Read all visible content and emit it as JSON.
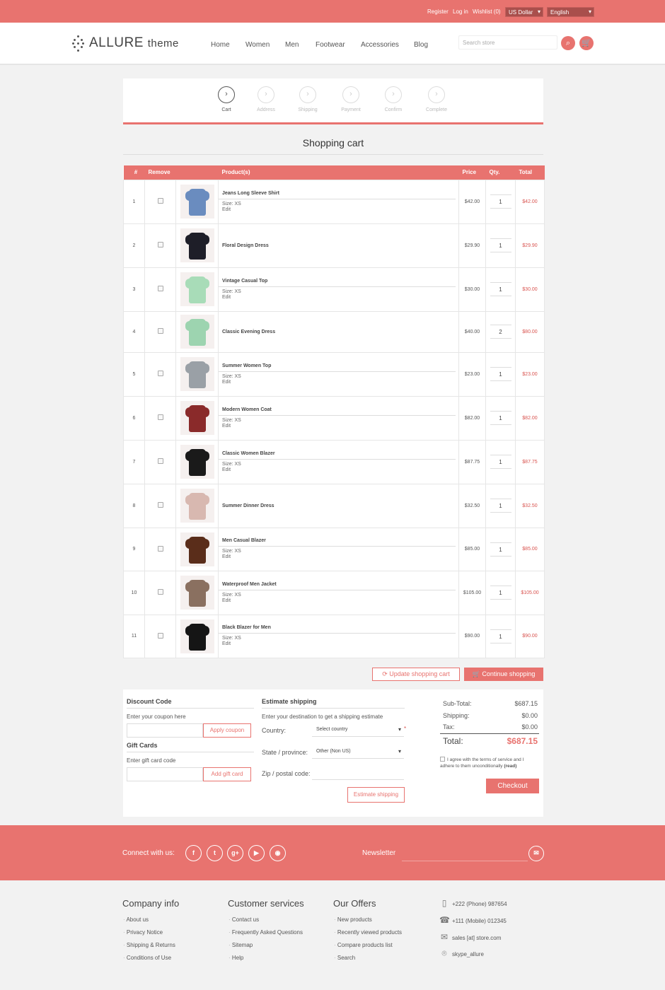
{
  "topbar": {
    "register": "Register",
    "login": "Log in",
    "wishlist": "Wishlist (0)",
    "currency": "US Dollar",
    "language": "English"
  },
  "brand": {
    "name": "ALLURE",
    "suffix": "theme"
  },
  "nav": [
    "Home",
    "Women",
    "Men",
    "Footwear",
    "Accessories",
    "Blog"
  ],
  "search": {
    "placeholder": "Search store"
  },
  "steps": [
    {
      "label": "Cart",
      "active": true
    },
    {
      "label": "Address"
    },
    {
      "label": "Shipping"
    },
    {
      "label": "Payment"
    },
    {
      "label": "Confirm"
    },
    {
      "label": "Complete"
    }
  ],
  "page_title": "Shopping cart",
  "table": {
    "headers": [
      "#",
      "Remove",
      "Product(s)",
      "Price",
      "Qty.",
      "Total"
    ],
    "rows": [
      {
        "n": "1",
        "name": "Jeans Long Sleeve Shirt",
        "size": "Size: XS",
        "edit": "Edit",
        "price": "$42.00",
        "qty": "1",
        "total": "$42.00",
        "color": "#6a8cbf"
      },
      {
        "n": "2",
        "name": "Floral Design Dress",
        "size": "",
        "edit": "",
        "price": "$29.90",
        "qty": "1",
        "total": "$29.90",
        "color": "#1e1e28"
      },
      {
        "n": "3",
        "name": "Vintage Casual Top",
        "size": "Size: XS",
        "edit": "Edit",
        "price": "$30.00",
        "qty": "1",
        "total": "$30.00",
        "color": "#a8dcb8"
      },
      {
        "n": "4",
        "name": "Classic Evening Dress",
        "size": "",
        "edit": "",
        "price": "$40.00",
        "qty": "2",
        "total": "$80.00",
        "color": "#9dd4b0"
      },
      {
        "n": "5",
        "name": "Summer Women Top",
        "size": "Size: XS",
        "edit": "Edit",
        "price": "$23.00",
        "qty": "1",
        "total": "$23.00",
        "color": "#9aa0a6"
      },
      {
        "n": "6",
        "name": "Modern Women Coat",
        "size": "Size: XS",
        "edit": "Edit",
        "price": "$82.00",
        "qty": "1",
        "total": "$82.00",
        "color": "#8a2a2a"
      },
      {
        "n": "7",
        "name": "Classic Women Blazer",
        "size": "Size: XS",
        "edit": "Edit",
        "price": "$87.75",
        "qty": "1",
        "total": "$87.75",
        "color": "#1a1a1a"
      },
      {
        "n": "8",
        "name": "Summer Dinner Dress",
        "size": "",
        "edit": "",
        "price": "$32.50",
        "qty": "1",
        "total": "$32.50",
        "color": "#d8b8b0"
      },
      {
        "n": "9",
        "name": "Men Casual Blazer",
        "size": "Size: XS",
        "edit": "Edit",
        "price": "$85.00",
        "qty": "1",
        "total": "$85.00",
        "color": "#5a2d1a"
      },
      {
        "n": "10",
        "name": "Waterproof Men Jacket",
        "size": "Size: XS",
        "edit": "Edit",
        "price": "$105.00",
        "qty": "1",
        "total": "$105.00",
        "color": "#8a7060"
      },
      {
        "n": "11",
        "name": "Black Blazer for Men",
        "size": "Size: XS",
        "edit": "Edit",
        "price": "$90.00",
        "qty": "1",
        "total": "$90.00",
        "color": "#151515"
      }
    ]
  },
  "actions": {
    "update": "Update shopping cart",
    "continue": "Continue shopping"
  },
  "discount": {
    "title": "Discount Code",
    "hint": "Enter your coupon here",
    "button": "Apply coupon"
  },
  "giftcard": {
    "title": "Gift Cards",
    "hint": "Enter gift card code",
    "button": "Add gift card"
  },
  "shipping": {
    "title": "Estimate shipping",
    "hint": "Enter your destination to get a shipping estimate",
    "country_label": "Country:",
    "country_value": "Select country",
    "state_label": "State / province:",
    "state_value": "Other (Non US)",
    "zip_label": "Zip / postal code:",
    "button": "Estimate shipping"
  },
  "totals": {
    "subtotal_label": "Sub-Total:",
    "subtotal": "$687.15",
    "shipping_label": "Shipping:",
    "shipping": "$0.00",
    "tax_label": "Tax:",
    "tax": "$0.00",
    "total_label": "Total:",
    "total": "$687.15",
    "terms": "I agree with the terms of service and I adhere to them unconditionally",
    "terms_read": "(read)",
    "checkout": "Checkout"
  },
  "footer": {
    "connect": "Connect with us:",
    "newsletter": "Newsletter",
    "company": {
      "title": "Company info",
      "links": [
        "About us",
        "Privacy Notice",
        "Shipping & Returns",
        "Conditions of Use"
      ]
    },
    "services": {
      "title": "Customer services",
      "links": [
        "Contact us",
        "Frequently Asked Questions",
        "Sitemap",
        "Help"
      ]
    },
    "offers": {
      "title": "Our Offers",
      "links": [
        "New products",
        "Recently viewed products",
        "Compare products list",
        "Search"
      ]
    },
    "contact": {
      "phone": "+222 (Phone) 987654",
      "mobile": "+111 (Mobile) 012345",
      "email": "sales [at] store.com",
      "skype": "skype_allure"
    }
  }
}
